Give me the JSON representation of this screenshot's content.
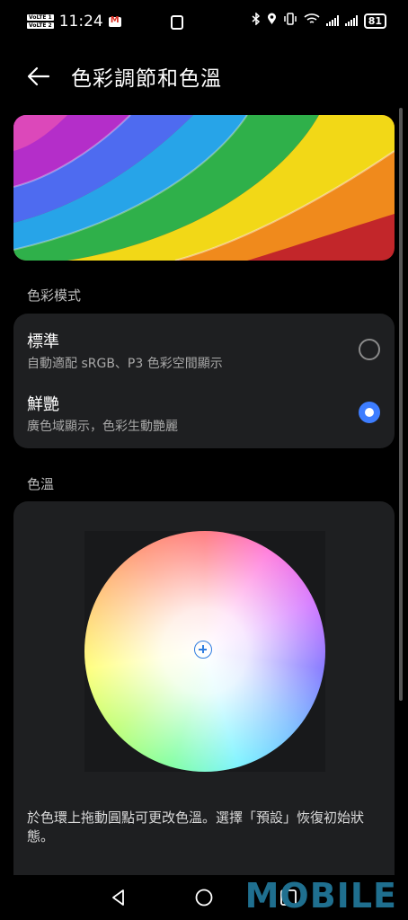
{
  "status_bar": {
    "volte_1": "VoLTE 1",
    "volte_2": "VoLTE 2",
    "time": "11:24",
    "notification_icon": "gmail-icon",
    "nfc_icon": "nfc-icon",
    "bluetooth_icon": "bluetooth-icon",
    "location_icon": "location-icon",
    "vibrate_icon": "vibrate-icon",
    "wifi_icon": "wifi-icon",
    "battery": "81"
  },
  "header": {
    "back_icon": "back-arrow-icon",
    "title": "色彩調節和色溫"
  },
  "color_mode": {
    "section_label": "色彩模式",
    "options": [
      {
        "title": "標準",
        "description": "自動適配 sRGB、P3 色彩空間顯示",
        "selected": false
      },
      {
        "title": "鮮艷",
        "description": "廣色域顯示，色彩生動艷麗",
        "selected": true
      }
    ]
  },
  "color_temperature": {
    "section_label": "色溫",
    "hint": "於色環上拖動圓點可更改色溫。選擇「預設」恢復初始狀態。"
  },
  "nav_bar": {
    "back_icon": "nav-back-icon",
    "home_icon": "nav-home-icon",
    "recents_icon": "nav-recents-icon"
  },
  "watermark": "MOBILE",
  "colors": {
    "background": "#000000",
    "card": "#1e1f21",
    "accent": "#3d7dff",
    "secondary_text": "#a8a8a8"
  }
}
